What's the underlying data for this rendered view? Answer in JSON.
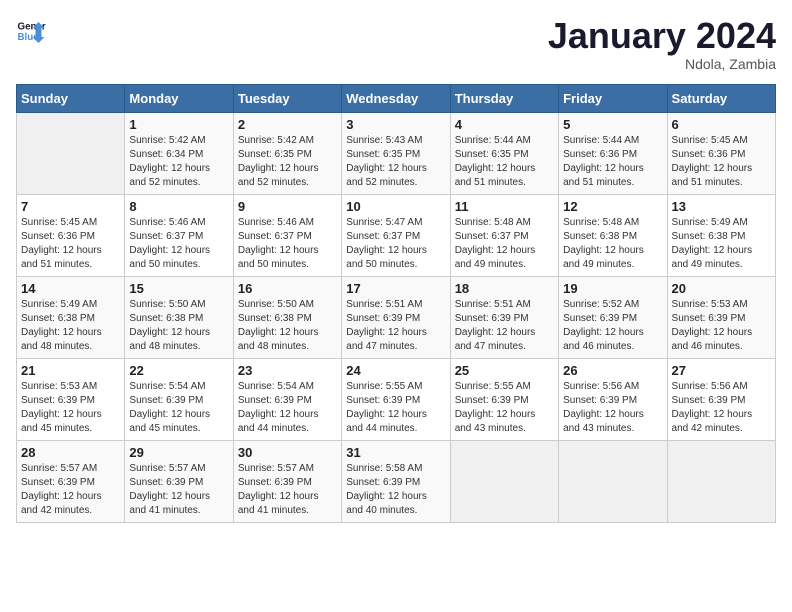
{
  "header": {
    "logo_line1": "General",
    "logo_line2": "Blue",
    "title": "January 2024",
    "subtitle": "Ndola, Zambia"
  },
  "days_of_week": [
    "Sunday",
    "Monday",
    "Tuesday",
    "Wednesday",
    "Thursday",
    "Friday",
    "Saturday"
  ],
  "weeks": [
    [
      {
        "day": "",
        "info": ""
      },
      {
        "day": "1",
        "info": "Sunrise: 5:42 AM\nSunset: 6:34 PM\nDaylight: 12 hours\nand 52 minutes."
      },
      {
        "day": "2",
        "info": "Sunrise: 5:42 AM\nSunset: 6:35 PM\nDaylight: 12 hours\nand 52 minutes."
      },
      {
        "day": "3",
        "info": "Sunrise: 5:43 AM\nSunset: 6:35 PM\nDaylight: 12 hours\nand 52 minutes."
      },
      {
        "day": "4",
        "info": "Sunrise: 5:44 AM\nSunset: 6:35 PM\nDaylight: 12 hours\nand 51 minutes."
      },
      {
        "day": "5",
        "info": "Sunrise: 5:44 AM\nSunset: 6:36 PM\nDaylight: 12 hours\nand 51 minutes."
      },
      {
        "day": "6",
        "info": "Sunrise: 5:45 AM\nSunset: 6:36 PM\nDaylight: 12 hours\nand 51 minutes."
      }
    ],
    [
      {
        "day": "7",
        "info": "Sunrise: 5:45 AM\nSunset: 6:36 PM\nDaylight: 12 hours\nand 51 minutes."
      },
      {
        "day": "8",
        "info": "Sunrise: 5:46 AM\nSunset: 6:37 PM\nDaylight: 12 hours\nand 50 minutes."
      },
      {
        "day": "9",
        "info": "Sunrise: 5:46 AM\nSunset: 6:37 PM\nDaylight: 12 hours\nand 50 minutes."
      },
      {
        "day": "10",
        "info": "Sunrise: 5:47 AM\nSunset: 6:37 PM\nDaylight: 12 hours\nand 50 minutes."
      },
      {
        "day": "11",
        "info": "Sunrise: 5:48 AM\nSunset: 6:37 PM\nDaylight: 12 hours\nand 49 minutes."
      },
      {
        "day": "12",
        "info": "Sunrise: 5:48 AM\nSunset: 6:38 PM\nDaylight: 12 hours\nand 49 minutes."
      },
      {
        "day": "13",
        "info": "Sunrise: 5:49 AM\nSunset: 6:38 PM\nDaylight: 12 hours\nand 49 minutes."
      }
    ],
    [
      {
        "day": "14",
        "info": "Sunrise: 5:49 AM\nSunset: 6:38 PM\nDaylight: 12 hours\nand 48 minutes."
      },
      {
        "day": "15",
        "info": "Sunrise: 5:50 AM\nSunset: 6:38 PM\nDaylight: 12 hours\nand 48 minutes."
      },
      {
        "day": "16",
        "info": "Sunrise: 5:50 AM\nSunset: 6:38 PM\nDaylight: 12 hours\nand 48 minutes."
      },
      {
        "day": "17",
        "info": "Sunrise: 5:51 AM\nSunset: 6:39 PM\nDaylight: 12 hours\nand 47 minutes."
      },
      {
        "day": "18",
        "info": "Sunrise: 5:51 AM\nSunset: 6:39 PM\nDaylight: 12 hours\nand 47 minutes."
      },
      {
        "day": "19",
        "info": "Sunrise: 5:52 AM\nSunset: 6:39 PM\nDaylight: 12 hours\nand 46 minutes."
      },
      {
        "day": "20",
        "info": "Sunrise: 5:53 AM\nSunset: 6:39 PM\nDaylight: 12 hours\nand 46 minutes."
      }
    ],
    [
      {
        "day": "21",
        "info": "Sunrise: 5:53 AM\nSunset: 6:39 PM\nDaylight: 12 hours\nand 45 minutes."
      },
      {
        "day": "22",
        "info": "Sunrise: 5:54 AM\nSunset: 6:39 PM\nDaylight: 12 hours\nand 45 minutes."
      },
      {
        "day": "23",
        "info": "Sunrise: 5:54 AM\nSunset: 6:39 PM\nDaylight: 12 hours\nand 44 minutes."
      },
      {
        "day": "24",
        "info": "Sunrise: 5:55 AM\nSunset: 6:39 PM\nDaylight: 12 hours\nand 44 minutes."
      },
      {
        "day": "25",
        "info": "Sunrise: 5:55 AM\nSunset: 6:39 PM\nDaylight: 12 hours\nand 43 minutes."
      },
      {
        "day": "26",
        "info": "Sunrise: 5:56 AM\nSunset: 6:39 PM\nDaylight: 12 hours\nand 43 minutes."
      },
      {
        "day": "27",
        "info": "Sunrise: 5:56 AM\nSunset: 6:39 PM\nDaylight: 12 hours\nand 42 minutes."
      }
    ],
    [
      {
        "day": "28",
        "info": "Sunrise: 5:57 AM\nSunset: 6:39 PM\nDaylight: 12 hours\nand 42 minutes."
      },
      {
        "day": "29",
        "info": "Sunrise: 5:57 AM\nSunset: 6:39 PM\nDaylight: 12 hours\nand 41 minutes."
      },
      {
        "day": "30",
        "info": "Sunrise: 5:57 AM\nSunset: 6:39 PM\nDaylight: 12 hours\nand 41 minutes."
      },
      {
        "day": "31",
        "info": "Sunrise: 5:58 AM\nSunset: 6:39 PM\nDaylight: 12 hours\nand 40 minutes."
      },
      {
        "day": "",
        "info": ""
      },
      {
        "day": "",
        "info": ""
      },
      {
        "day": "",
        "info": ""
      }
    ]
  ]
}
